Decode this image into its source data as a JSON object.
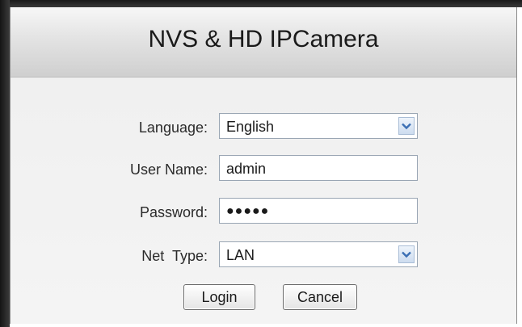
{
  "title": "NVS & HD IPCamera",
  "form": {
    "language": {
      "label": "Language:",
      "value": "English"
    },
    "username": {
      "label": "User Name:",
      "value": "admin"
    },
    "password": {
      "label": "Password:",
      "masked_value": "●●●●●"
    },
    "net_type": {
      "label": "Net  Type:",
      "value": "LAN"
    }
  },
  "buttons": {
    "login_label": "Login",
    "cancel_label": "Cancel"
  },
  "icons": {
    "dropdown": "chevron-down-icon"
  },
  "colors": {
    "arrow": "#3c6fb4",
    "field_border": "#9aa6b4"
  }
}
